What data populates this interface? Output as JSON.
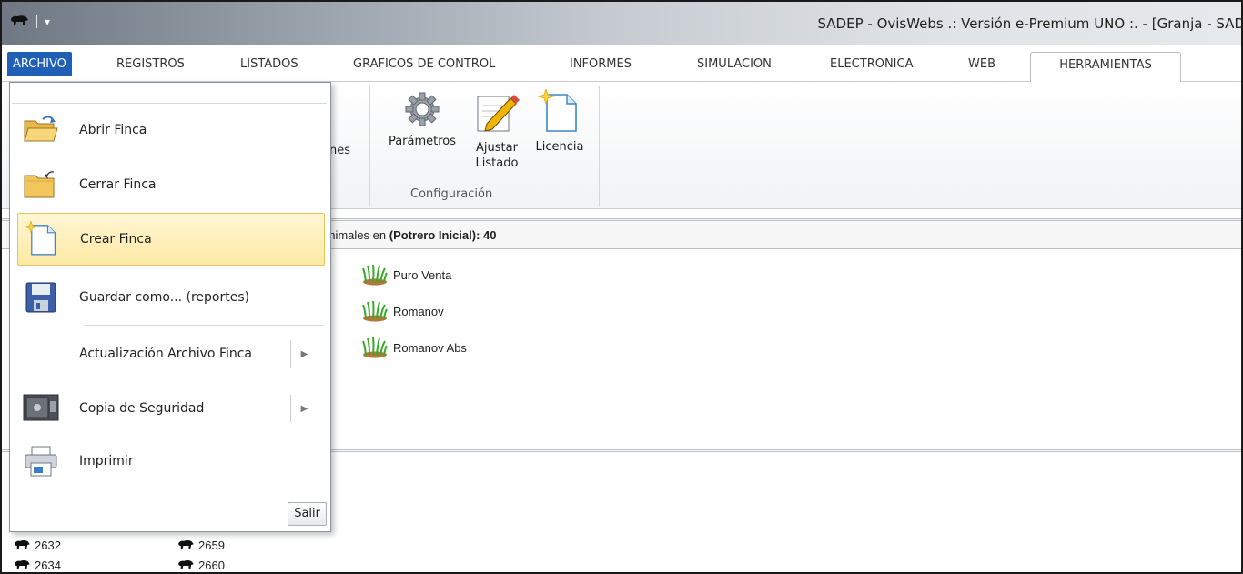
{
  "window": {
    "title": "SADEP - OvisWebs  .: Versión e-Premium UNO :. - [Granja - SAD"
  },
  "tabs": [
    {
      "label": "ARCHIVO"
    },
    {
      "label": "REGISTROS"
    },
    {
      "label": "LISTADOS"
    },
    {
      "label": "GRAFICOS DE CONTROL"
    },
    {
      "label": "INFORMES"
    },
    {
      "label": "SIMULACION"
    },
    {
      "label": "ELECTRONICA"
    },
    {
      "label": "WEB"
    },
    {
      "label": "HERRAMIENTAS"
    }
  ],
  "ribbon": {
    "partial_label": "ones",
    "buttons": [
      {
        "label": "Parámetros",
        "icon": "gear-icon"
      },
      {
        "label": "Ajustar Listado",
        "icon": "edit-pencil-icon"
      },
      {
        "label": "Licencia",
        "icon": "new-document-icon"
      }
    ],
    "group_label": "Configuración"
  },
  "infobar": {
    "prefix": "animales en",
    "location": "(Potrero Inicial): 40"
  },
  "pastures": [
    "Puro Venta",
    "Romanov",
    "Romanov Abs"
  ],
  "animals": [
    "2632",
    "2659",
    "2634",
    "2660"
  ],
  "file_menu": {
    "items": [
      {
        "label": "Abrir Finca",
        "icon": "open-folder-icon"
      },
      {
        "label": "Cerrar Finca",
        "icon": "close-folder-icon"
      },
      {
        "label": "Crear Finca",
        "icon": "new-document-icon"
      },
      {
        "label": "Guardar como... (reportes)",
        "icon": "floppy-disk-icon"
      },
      {
        "label": "Actualización Archivo Finca"
      },
      {
        "label": "Copia de Seguridad",
        "icon": "safe-icon"
      },
      {
        "label": "Imprimir",
        "icon": "printer-icon"
      }
    ],
    "exit_label": "Salir"
  }
}
